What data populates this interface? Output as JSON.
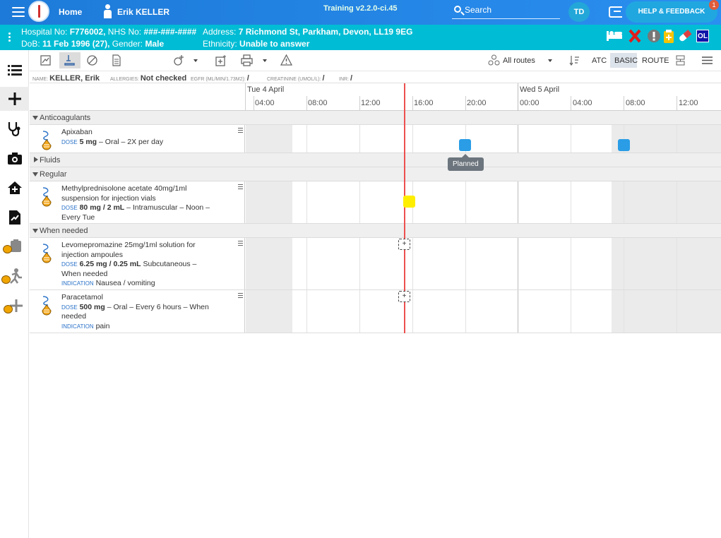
{
  "topbar": {
    "home_label": "Home",
    "user_name": "Erik KELLER",
    "version": "Training v2.2.0-ci.45",
    "search_label": "Search",
    "avatar_initials": "TD",
    "help_label": "HELP & FEEDBACK",
    "notification_count": "1"
  },
  "patient": {
    "line1_hospital_label": "Hospital No:",
    "hospital_no": "F776002,",
    "nhs_label": "NHS No:",
    "nhs_no": "###-###-####",
    "address_label": "Address:",
    "address": "7 Richmond St, Parkham, Devon, LL19 9EG",
    "dob_label": "DoB:",
    "dob": "11 Feb 1996 (27),",
    "gender_label": "Gender:",
    "gender": "Male",
    "ethnicity_label": "Ethnicity:",
    "ethnicity": "Unable to answer",
    "status_badge": "OL"
  },
  "toolbar": {
    "routes_label": "All routes",
    "atc_label": "ATC",
    "basic_label": "BASIC",
    "route_label": "ROUTE"
  },
  "infobar": {
    "name_label": "NAME:",
    "name_value": "KELLER, Erik",
    "allergies_label": "ALLERGIES:",
    "allergies_value": "Not checked",
    "egfr_label": "EGFR (ML/MIN/1.73M2):",
    "egfr_value": "/",
    "creatinine_label": "CREATININE (UMOL/L):",
    "creatinine_value": "/",
    "inr_label": "INR:",
    "inr_value": "/"
  },
  "timeline": {
    "days": [
      "Tue 4 April",
      "Wed 5 April"
    ],
    "hours": [
      "04:00",
      "08:00",
      "12:00",
      "16:00",
      "20:00",
      "00:00",
      "04:00",
      "08:00",
      "12:00"
    ]
  },
  "sections": {
    "anticoagulants": "Anticoagulants",
    "fluids": "Fluids",
    "regular": "Regular",
    "when_needed": "When needed"
  },
  "meds": {
    "apixaban": {
      "name": "Apixaban",
      "dose_label": "DOSE",
      "dose": "5 mg",
      "rest": " – Oral – 2X per day"
    },
    "methyl": {
      "name": "Methylprednisolone acetate 40mg/1ml suspension for injection vials",
      "dose_label": "DOSE",
      "dose": "80 mg / 2 mL",
      "rest": " – Intramuscular – Noon – Every Tue"
    },
    "levo": {
      "name": "Levomepromazine 25mg/1ml solution for injection ampoules",
      "dose_label": "DOSE",
      "dose": "6.25 mg / 0.25 mL",
      "rest": " Subcutaneous – When needed",
      "indication_label": "INDICATION",
      "indication": "Nausea / vomiting"
    },
    "paracetamol": {
      "name": "Paracetamol",
      "dose_label": "DOSE",
      "dose": "500 mg",
      "rest": " – Oral – Every 6 hours – When needed",
      "indication_label": "INDICATION",
      "indication": "pain"
    }
  },
  "tooltip": "Planned",
  "prn_add": "+",
  "colors": {
    "topbar": "#1d7ad8",
    "patientbar": "#00bcd4",
    "dose_planned": "#2a9de6",
    "dose_regular": "#ffee00",
    "now_line": "#ee5050"
  }
}
